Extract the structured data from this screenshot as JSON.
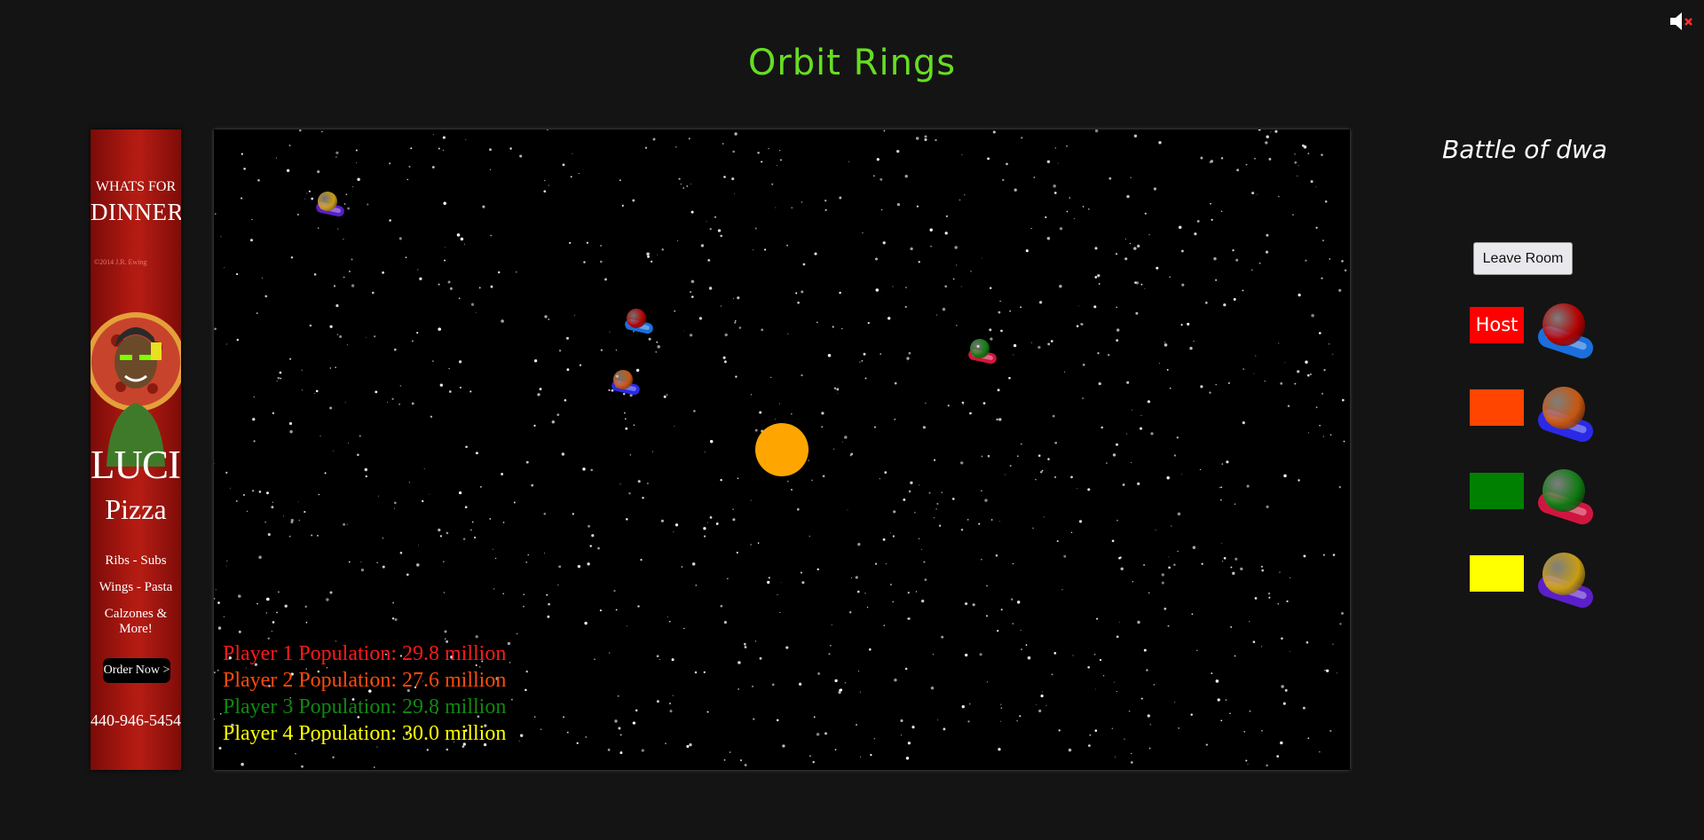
{
  "title": "Orbit Rings",
  "mute_icon": "speaker-muted-icon",
  "ad": {
    "line1": "WHATS FOR",
    "line2": "DINNER?",
    "copyright": "©2014 J.R. Ewing",
    "brand_line1": "LUCIO'S",
    "brand_line2": "Pizza",
    "menu": [
      "Ribs - Subs",
      "Wings - Pasta",
      "Calzones & More!"
    ],
    "cta": "Order Now >",
    "phone": "440-946-5454",
    "colors": {
      "background": "#b01a12",
      "accent": "#000000"
    }
  },
  "game": {
    "sun_color": "#ffa500",
    "players": [
      {
        "label": "Player 1 Population: 29.8 million",
        "color": "#ff1a1a",
        "planet": "#b30000",
        "saucer": "#1a6fdc"
      },
      {
        "label": "Player 2 Population: 27.6 million",
        "color": "#ff4b0a",
        "planet": "#c7560f",
        "saucer": "#2a2ae6"
      },
      {
        "label": "Player 3 Population: 29.8 million",
        "color": "#118811",
        "planet": "#0f7a12",
        "saucer": "#d0163f"
      },
      {
        "label": "Player 4 Population: 30.0 million",
        "color": "#ffff00",
        "planet": "#c89c12",
        "saucer": "#5b1fc9"
      }
    ]
  },
  "panel": {
    "room_name": "Battle of dwa",
    "leave_label": "Leave Room",
    "host_label": "Host",
    "swatch_colors": [
      "#ff0000",
      "#ff4500",
      "#008000",
      "#ffff00"
    ]
  }
}
